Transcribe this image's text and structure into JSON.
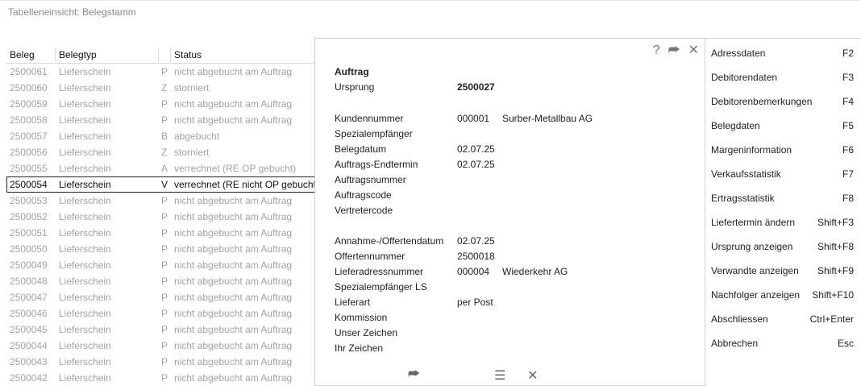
{
  "window": {
    "title": "Tabelleneinsicht: Belegstamm"
  },
  "grid": {
    "headers": {
      "beleg": "Beleg",
      "belegtyp": "Belegtyp",
      "status": "Status"
    },
    "rows": [
      {
        "beleg": "2500061",
        "typ": "Lieferschein",
        "k": "P",
        "status": "nicht abgebucht am Auftrag"
      },
      {
        "beleg": "2500060",
        "typ": "Lieferschein",
        "k": "Z",
        "status": "storniert"
      },
      {
        "beleg": "2500059",
        "typ": "Lieferschein",
        "k": "P",
        "status": "nicht abgebucht am Auftrag"
      },
      {
        "beleg": "2500058",
        "typ": "Lieferschein",
        "k": "P",
        "status": "nicht abgebucht am Auftrag"
      },
      {
        "beleg": "2500057",
        "typ": "Lieferschein",
        "k": "B",
        "status": "abgebucht"
      },
      {
        "beleg": "2500056",
        "typ": "Lieferschein",
        "k": "Z",
        "status": "storniert"
      },
      {
        "beleg": "2500055",
        "typ": "Lieferschein",
        "k": "A",
        "status": "verrechnet (RE OP gebucht)"
      },
      {
        "beleg": "2500054",
        "typ": "Lieferschein",
        "k": "V",
        "status": "verrechnet (RE nicht OP gebucht)",
        "selected": true
      },
      {
        "beleg": "2500053",
        "typ": "Lieferschein",
        "k": "P",
        "status": "nicht abgebucht am Auftrag"
      },
      {
        "beleg": "2500052",
        "typ": "Lieferschein",
        "k": "P",
        "status": "nicht abgebucht am Auftrag"
      },
      {
        "beleg": "2500051",
        "typ": "Lieferschein",
        "k": "P",
        "status": "nicht abgebucht am Auftrag"
      },
      {
        "beleg": "2500050",
        "typ": "Lieferschein",
        "k": "P",
        "status": "nicht abgebucht am Auftrag"
      },
      {
        "beleg": "2500049",
        "typ": "Lieferschein",
        "k": "P",
        "status": "nicht abgebucht am Auftrag"
      },
      {
        "beleg": "2500048",
        "typ": "Lieferschein",
        "k": "P",
        "status": "nicht abgebucht am Auftrag"
      },
      {
        "beleg": "2500047",
        "typ": "Lieferschein",
        "k": "P",
        "status": "nicht abgebucht am Auftrag"
      },
      {
        "beleg": "2500046",
        "typ": "Lieferschein",
        "k": "P",
        "status": "nicht abgebucht am Auftrag"
      },
      {
        "beleg": "2500045",
        "typ": "Lieferschein",
        "k": "P",
        "status": "nicht abgebucht am Auftrag"
      },
      {
        "beleg": "2500044",
        "typ": "Lieferschein",
        "k": "P",
        "status": "nicht abgebucht am Auftrag"
      },
      {
        "beleg": "2500043",
        "typ": "Lieferschein",
        "k": "P",
        "status": "nicht abgebucht am Auftrag"
      },
      {
        "beleg": "2500042",
        "typ": "Lieferschein",
        "k": "P",
        "status": "nicht abgebucht am Auftrag"
      }
    ]
  },
  "detail": {
    "heading": "Auftrag",
    "ursprung_label": "Ursprung",
    "ursprung_value": "2500027",
    "kundennummer_label": "Kundennummer",
    "kundennummer_value": "000001",
    "kunde_name": "Surber-Metallbau AG",
    "spezialempfaenger_label": "Spezialempfänger",
    "belegdatum_label": "Belegdatum",
    "belegdatum_value": "02.07.25",
    "endtermin_label": "Auftrags-Endtermin",
    "endtermin_value": "02.07.25",
    "auftragsnummer_label": "Auftragsnummer",
    "auftragscode_label": "Auftragscode",
    "vertretercode_label": "Vertretercode",
    "annahme_label": "Annahme-/Offertendatum",
    "annahme_value": "02.07.25",
    "offertennummer_label": "Offertennummer",
    "offertennummer_value": "2500018",
    "lieferadresse_label": "Lieferadressnummer",
    "lieferadresse_value": "000004",
    "lieferadresse_name": "Wiederkehr AG",
    "spezialempfaenger_ls_label": "Spezialempfänger LS",
    "lieferart_label": "Lieferart",
    "lieferart_value": "per Post",
    "kommission_label": "Kommission",
    "unser_zeichen_label": "Unser Zeichen",
    "ihr_zeichen_label": "Ihr Zeichen",
    "icons": {
      "help": "?",
      "forward": "⮫",
      "close": "✕"
    },
    "footer_icons": {
      "forward": "⮫",
      "list": "☰",
      "close": "✕"
    }
  },
  "menu": [
    {
      "label": "Adressdaten",
      "key": "F2"
    },
    {
      "label": "Debitorendaten",
      "key": "F3"
    },
    {
      "label": "Debitorenbemerkungen",
      "key": "F4"
    },
    {
      "label": "Belegdaten",
      "key": "F5"
    },
    {
      "label": "Margeninformation",
      "key": "F6"
    },
    {
      "label": "Verkaufsstatistik",
      "key": "F7"
    },
    {
      "label": "Ertragsstatistik",
      "key": "F8"
    },
    {
      "label": "Liefertermin ändern",
      "key": "Shift+F3"
    },
    {
      "label": "Ursprung anzeigen",
      "key": "Shift+F8"
    },
    {
      "label": "Verwandte anzeigen",
      "key": "Shift+F9"
    },
    {
      "label": "Nachfolger anzeigen",
      "key": "Shift+F10"
    },
    {
      "label": "Abschliessen",
      "key": "Ctrl+Enter"
    },
    {
      "label": "Abbrechen",
      "key": "Esc"
    }
  ]
}
